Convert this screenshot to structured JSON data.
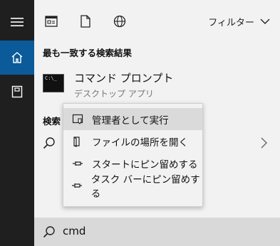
{
  "tabs": {
    "filter_label": "フィルター"
  },
  "best_match": {
    "section_title": "最も一致する検索結果",
    "app_name": "コマンド プロンプト",
    "app_type": "デスクトップ アプリ"
  },
  "web": {
    "section_title_visible": "検索"
  },
  "context_menu": {
    "items": [
      {
        "label": "管理者として実行",
        "icon": "shield-run-icon"
      },
      {
        "label": "ファイルの場所を開く",
        "icon": "folder-open-icon"
      },
      {
        "label": "スタートにピン留めする",
        "icon": "pin-icon"
      },
      {
        "label": "タスク バーにピン留めする",
        "icon": "pin-icon"
      }
    ]
  },
  "search": {
    "query": "cmd"
  },
  "colors": {
    "rail_bg": "#1f1f1f",
    "accent_blue": "#0b5a9a",
    "panel_bg": "#f2f2f2",
    "search_bg": "#d9d9d9"
  }
}
